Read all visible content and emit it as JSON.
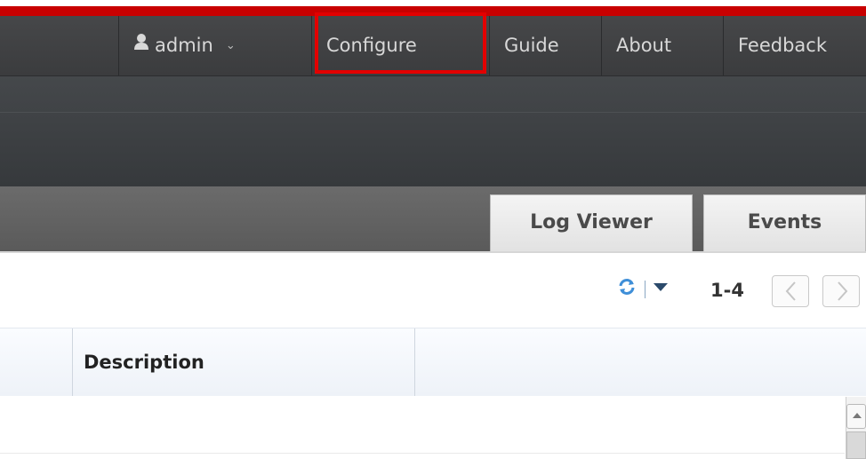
{
  "utility_nav": {
    "user": "admin",
    "items": [
      "Configure",
      "Guide",
      "About",
      "Feedback"
    ]
  },
  "tabs": [
    "Log Viewer",
    "Events"
  ],
  "toolbar": {
    "range": "1-4"
  },
  "table": {
    "columns": [
      "",
      "Description",
      ""
    ]
  },
  "highlight_target": "Configure",
  "colors": {
    "brand_red": "#c80000",
    "highlight_box": "#e30000",
    "nav_bg": "#3b3c3e"
  }
}
